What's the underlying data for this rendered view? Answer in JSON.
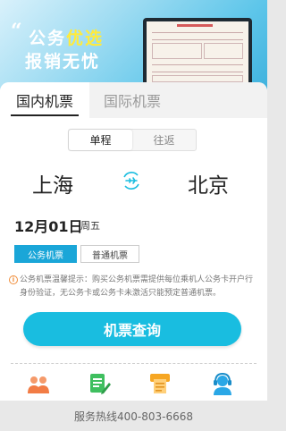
{
  "banner": {
    "quote_mark": "“",
    "line1_white": "公务",
    "line1_yellow": "优选",
    "line2": "报销无忧"
  },
  "tabs": [
    {
      "label": "国内机票",
      "active": true
    },
    {
      "label": "国际机票",
      "active": false
    }
  ],
  "trip_toggle": {
    "oneway": "单程",
    "round": "往返"
  },
  "route": {
    "from": "上海",
    "to": "北京"
  },
  "date": {
    "value": "12月01日",
    "weekday": "周五"
  },
  "ticket_type": {
    "official": "公务机票",
    "normal": "普通机票"
  },
  "notice": {
    "text": "公务机票温馨提示：购买公务机票需提供每位乘机人公务卡开户行身份验证，无公务卡或公务卡未激活只能预定普通机票。"
  },
  "search_button": "机票查询",
  "footer": {
    "hotline": "服务热线400-803-6668"
  },
  "colors": {
    "accent": "#19bde0",
    "official_tab": "#1aa6d8",
    "notice_icon": "#f08d3a"
  },
  "icons": [
    "people-icon",
    "document-pen-icon",
    "printer-icon",
    "customer-service-icon"
  ]
}
